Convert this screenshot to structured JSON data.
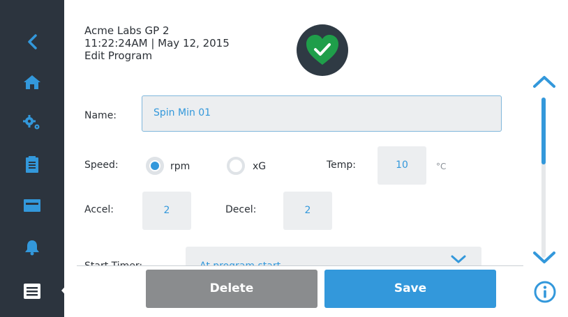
{
  "header": {
    "device_name": "Acme Labs GP 2",
    "datetime": "11:22:24AM | May 12, 2015",
    "screen_title": "Edit Program"
  },
  "status": {
    "icon": "heart-check-icon",
    "color": "#1f9e4a"
  },
  "sidebar": {
    "items": [
      {
        "icon": "back-chevron-icon"
      },
      {
        "icon": "home-icon"
      },
      {
        "icon": "gears-icon"
      },
      {
        "icon": "clipboard-icon"
      },
      {
        "icon": "card-icon"
      },
      {
        "icon": "bell-icon"
      },
      {
        "icon": "programs-list-icon",
        "active": true
      }
    ]
  },
  "form": {
    "name": {
      "label": "Name:",
      "value": "Spin Min 01"
    },
    "speed": {
      "label": "Speed:",
      "options": [
        {
          "label": "rpm",
          "selected": true
        },
        {
          "label": "xG",
          "selected": false
        }
      ]
    },
    "temp": {
      "label": "Temp:",
      "value": "10",
      "unit": "°C"
    },
    "accel": {
      "label": "Accel:",
      "value": "2"
    },
    "decel": {
      "label": "Decel:",
      "value": "2"
    },
    "start_timer": {
      "label": "Start Timer:",
      "value": "At program start"
    }
  },
  "buttons": {
    "delete_label": "Delete",
    "save_label": "Save"
  },
  "scroll": {
    "position": 0.0
  },
  "colors": {
    "accent": "#3398db",
    "sidebar": "#2c343e",
    "delete": "#8a8c8e",
    "status_ok": "#1f9e4a"
  }
}
